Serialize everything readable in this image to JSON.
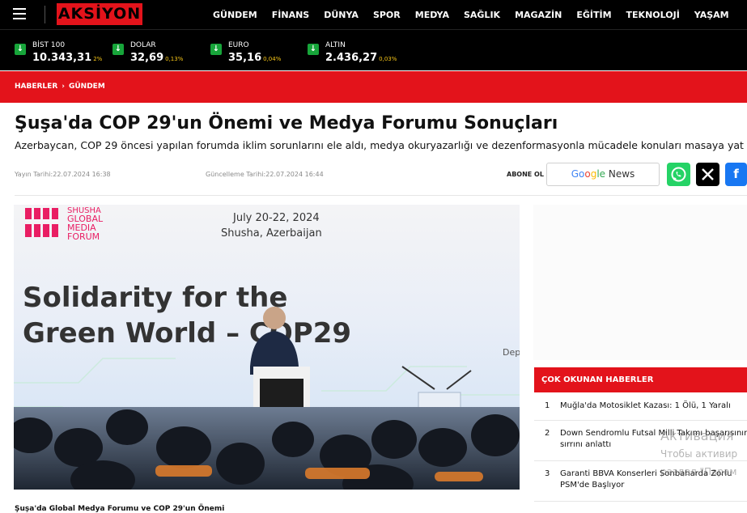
{
  "header": {
    "logo_text": "AKSİYON",
    "nav": [
      "GÜNDEM",
      "FİNANS",
      "DÜNYA",
      "SPOR",
      "MEDYA",
      "SAĞLIK",
      "MAGAZİN",
      "EĞİTİM",
      "TEKNOLOJİ",
      "YAŞAM"
    ]
  },
  "ticker": [
    {
      "name": "BİST 100",
      "value": "10.343,31",
      "change": "2%",
      "direction": "down"
    },
    {
      "name": "DOLAR",
      "value": "32,69",
      "change": "0,13%",
      "direction": "down"
    },
    {
      "name": "EURO",
      "value": "35,16",
      "change": "0,04%",
      "direction": "down"
    },
    {
      "name": "ALTIN",
      "value": "2.436,27",
      "change": "0,03%",
      "direction": "down"
    }
  ],
  "breadcrumb": {
    "home": "HABERLER",
    "separator": "›",
    "current": "GÜNDEM"
  },
  "article": {
    "title": "Şuşa'da COP 29'un Önemi ve Medya Forumu Sonuçları",
    "summary": "Azerbaycan, COP 29 öncesi yapılan forumda iklim sorunlarını ele aldı, medya okuryazarlığı ve dezenformasyonla mücadele konuları masaya yat",
    "published": "Yayın Tarihi:22.07.2024 16:38",
    "updated": "Güncelleme Tarihi:22.07.2024 16:44",
    "follow_label": "ABONE OL",
    "google_news": [
      "Go",
      "o",
      "g",
      "le",
      " News"
    ],
    "caption": "Şuşa'da Global Medya Forumu ve COP 29'un Önemi"
  },
  "hero_image": {
    "logo_lines": [
      "SHUSHA",
      "GLOBAL",
      "MEDIA",
      "FORUM"
    ],
    "date": "July 20-22, 2024",
    "place": "Shusha, Azerbaijan",
    "slogan_line1": "Solidarity for the",
    "slogan_line2": "Green World – COP29",
    "side_text": "Dep"
  },
  "popular": {
    "title": "ÇOK OKUNAN HABERLER",
    "items": [
      {
        "num": "1",
        "text": "Muğla'da Motosiklet Kazası: 1 Ölü, 1 Yaralı"
      },
      {
        "num": "2",
        "text": "Down Sendromlu Futsal Milli Takımı başarısının sırrını anlattı"
      },
      {
        "num": "3",
        "text": "Garanti BBVA Konserleri Sonbaharda Zorlu PSM'de Başlıyor"
      }
    ]
  },
  "watermark": {
    "line1": "Активация",
    "line2": "Чтобы активир",
    "line3": "раздел \"Парам"
  },
  "colors": {
    "brand_red": "#e3131b",
    "ticker_bg": "#000000",
    "down_green": "#17a53a",
    "whatsapp": "#25d366",
    "facebook": "#1877f2"
  }
}
